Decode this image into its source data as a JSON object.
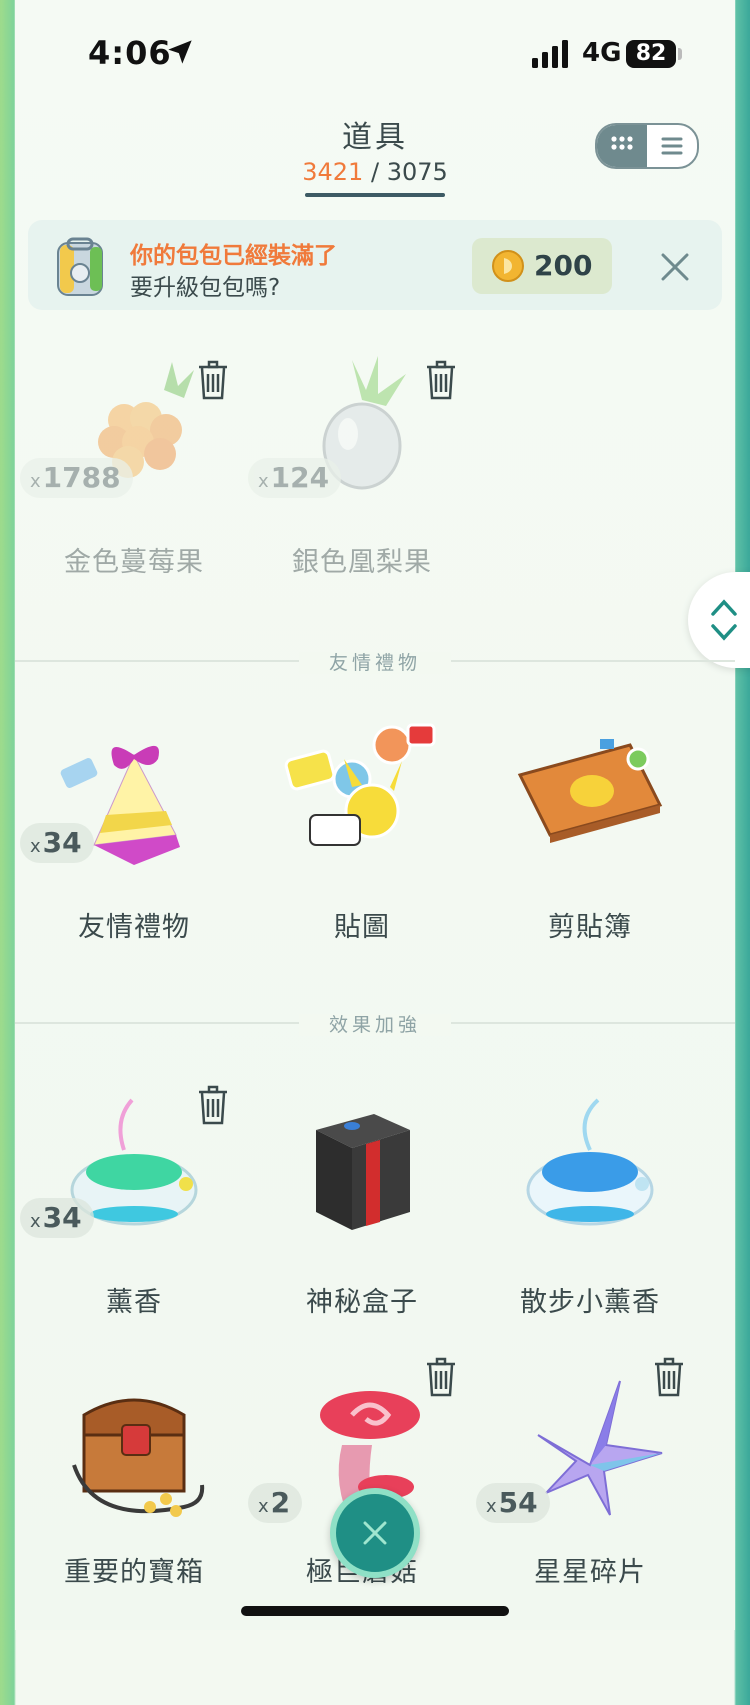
{
  "status_bar": {
    "time": "4:06",
    "network": "4G",
    "battery": "82"
  },
  "header": {
    "title": "道具",
    "count_current": "3421",
    "count_separator": "/",
    "count_max": "3075"
  },
  "banner": {
    "title": "你的包包已經裝滿了",
    "subtitle": "要升級包包嗎?",
    "price": "200"
  },
  "sections": [
    {
      "label": "友情禮物"
    },
    {
      "label": "效果加強"
    }
  ],
  "items": [
    {
      "name": "金色蔓莓果",
      "count": "1788",
      "icon": "golden-razz-berry-icon"
    },
    {
      "name": "銀色凰梨果",
      "count": "124",
      "icon": "silver-pinap-berry-icon"
    },
    {
      "name": "友情禮物",
      "count": "34",
      "icon": "gift-icon"
    },
    {
      "name": "貼圖",
      "count": "",
      "icon": "stickers-icon"
    },
    {
      "name": "剪貼簿",
      "count": "",
      "icon": "scrapbook-icon"
    },
    {
      "name": "薰香",
      "count": "34",
      "icon": "incense-icon"
    },
    {
      "name": "神秘盒子",
      "count": "",
      "icon": "mystery-box-icon"
    },
    {
      "name": "散步小薰香",
      "count": "",
      "icon": "daily-adventure-incense-icon"
    },
    {
      "name": "重要的寶箱",
      "count": "",
      "icon": "treasure-chest-icon"
    },
    {
      "name": "極巨蘑菇",
      "count": "2",
      "icon": "max-mushroom-icon"
    },
    {
      "name": "星星碎片",
      "count": "54",
      "icon": "star-piece-icon"
    }
  ],
  "count_prefix": "x",
  "colors": {
    "accent": "#f07a3b",
    "teal": "#1f8f85"
  }
}
